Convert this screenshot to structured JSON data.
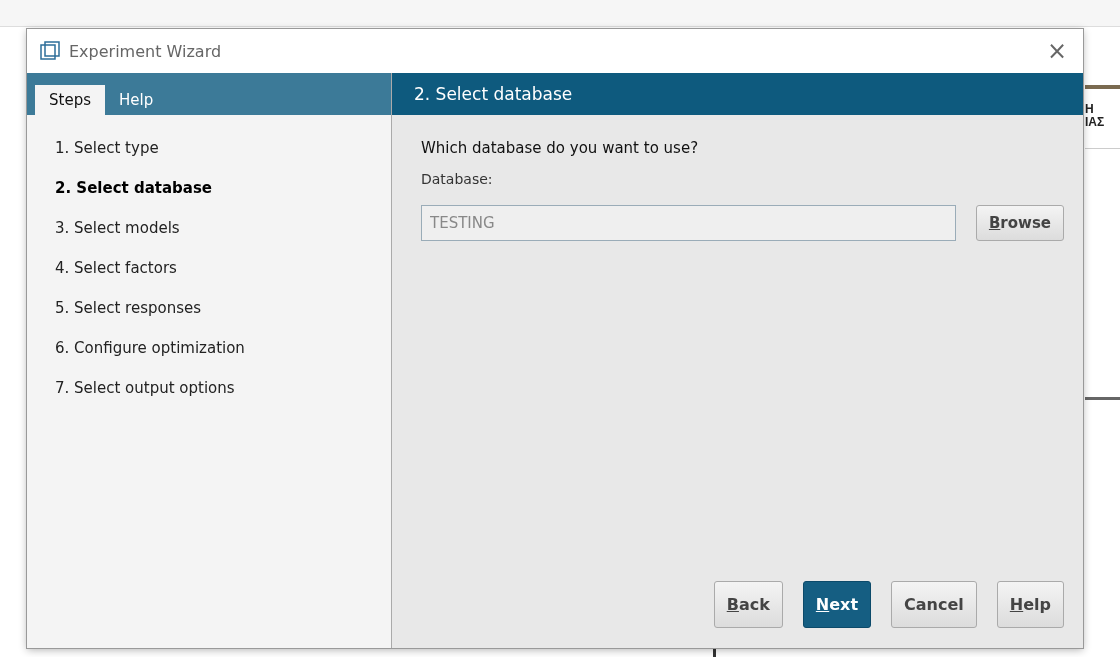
{
  "background": {
    "column_heading_lines": [
      "Η",
      "ΙΑΣ"
    ]
  },
  "window": {
    "title": "Experiment Wizard",
    "close": "×"
  },
  "sidebar": {
    "tabs": [
      {
        "label": "Steps",
        "selected": true
      },
      {
        "label": "Help",
        "selected": false
      }
    ],
    "steps": [
      {
        "label": "1. Select type",
        "selected": false
      },
      {
        "label": "2. Select database",
        "selected": true
      },
      {
        "label": "3. Select models",
        "selected": false
      },
      {
        "label": "4. Select factors",
        "selected": false
      },
      {
        "label": "5. Select responses",
        "selected": false
      },
      {
        "label": "6. Configure optimization",
        "selected": false
      },
      {
        "label": "7. Select output options",
        "selected": false
      }
    ]
  },
  "page": {
    "heading": "2. Select database",
    "question": "Which database do you want to use?",
    "field_label": "Database:",
    "field_value": "TESTING",
    "field_disabled": true,
    "browse": {
      "accel": "B",
      "rest": "rowse"
    }
  },
  "buttons": [
    {
      "accel": "B",
      "rest": "ack",
      "primary": false
    },
    {
      "accel": "N",
      "rest": "ext",
      "primary": true
    },
    {
      "rest": "Cancel",
      "primary": false
    },
    {
      "accel": "H",
      "rest": "elp",
      "primary": false
    }
  ]
}
